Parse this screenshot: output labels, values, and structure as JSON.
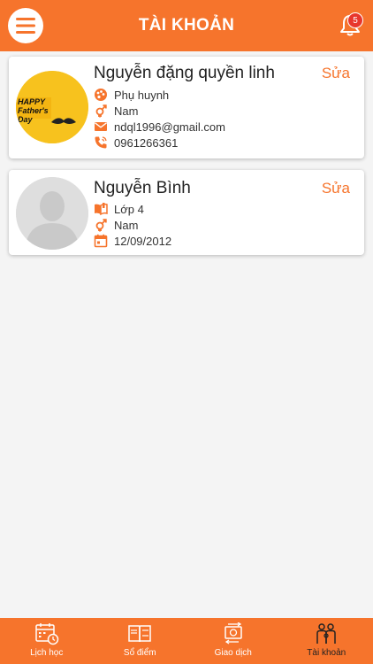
{
  "header": {
    "title": "TÀI KHOẢN",
    "notification_count": "5"
  },
  "accounts": [
    {
      "name": "Nguyễn đặng quyền linh",
      "edit_label": "Sửa",
      "avatar_caption": "HAPPY Father's Day",
      "role": "Phụ huynh",
      "gender": "Nam",
      "email": "ndql1996@gmail.com",
      "phone": "0961266361"
    },
    {
      "name": "Nguyễn Bình",
      "edit_label": "Sửa",
      "class": "Lớp 4",
      "gender": "Nam",
      "birthday": "12/09/2012"
    }
  ],
  "tabs": [
    {
      "label": "Lịch học",
      "icon": "calendar-clock-icon"
    },
    {
      "label": "Sổ điểm",
      "icon": "gradebook-icon"
    },
    {
      "label": "Giao dịch",
      "icon": "transaction-icon"
    },
    {
      "label": "Tài khoản",
      "icon": "family-icon",
      "active": true
    }
  ],
  "colors": {
    "primary": "#f6742c",
    "badge": "#e8362d",
    "background": "#f4f4f4"
  }
}
